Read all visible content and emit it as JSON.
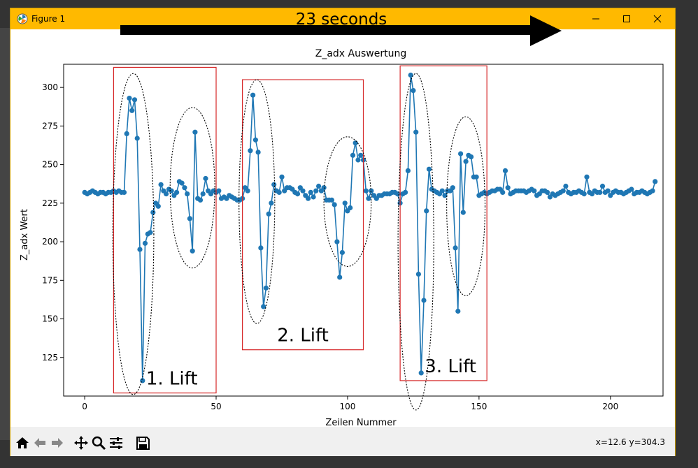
{
  "window": {
    "title": "Figure 1",
    "icon": "matplotlib-icon",
    "accent_color": "#ffb900"
  },
  "overlay": {
    "arrow_label": "23 seconds",
    "lift_labels": [
      "1. Lift",
      "2. Lift",
      "3. Lift"
    ],
    "box_color": "#d62728"
  },
  "toolbar": {
    "buttons": [
      "home-icon",
      "back-icon",
      "forward-icon",
      "pan-icon",
      "zoom-icon",
      "configure-subplots-icon",
      "save-icon"
    ],
    "coordinates": "x=12.6 y=304.3"
  },
  "chart_data": {
    "type": "line",
    "title": "Z_adx Auswertung",
    "xlabel": "Zeilen Nummer",
    "ylabel": "Z_adx Wert",
    "xlim": [
      -8,
      220
    ],
    "ylim": [
      100,
      315
    ],
    "xticks": [
      0,
      50,
      100,
      150,
      200
    ],
    "yticks": [
      125,
      150,
      175,
      200,
      225,
      250,
      275,
      300
    ],
    "series_color": "#1f77b4",
    "marker": "circle",
    "grid": false,
    "y": [
      232,
      231,
      232,
      233,
      232,
      231,
      232,
      232,
      231,
      232,
      232,
      233,
      232,
      233,
      232,
      232,
      270,
      293,
      285,
      292,
      267,
      195,
      110,
      199,
      205,
      206,
      219,
      225,
      223,
      237,
      233,
      231,
      234,
      233,
      230,
      232,
      239,
      238,
      235,
      231,
      215,
      194,
      271,
      228,
      227,
      231,
      241,
      233,
      231,
      233,
      232,
      233,
      228,
      229,
      228,
      230,
      229,
      228,
      227,
      227,
      228,
      235,
      233,
      259,
      295,
      266,
      258,
      196,
      158,
      170,
      218,
      225,
      237,
      233,
      232,
      242,
      233,
      235,
      235,
      234,
      232,
      231,
      235,
      233,
      230,
      228,
      232,
      229,
      233,
      236,
      233,
      235,
      227,
      227,
      227,
      224,
      200,
      177,
      193,
      225,
      220,
      222,
      256,
      264,
      253,
      256,
      253,
      233,
      228,
      233,
      230,
      228,
      230,
      230,
      231,
      231,
      231,
      232,
      232,
      231,
      225,
      231,
      232,
      246,
      308,
      298,
      271,
      179,
      115,
      162,
      220,
      247,
      234,
      233,
      232,
      231,
      233,
      230,
      233,
      233,
      235,
      196,
      155,
      257,
      219,
      252,
      256,
      255,
      242,
      242,
      230,
      231,
      232,
      231,
      232,
      233,
      233,
      234,
      234,
      232,
      246,
      235,
      231,
      232,
      233,
      233,
      233,
      233,
      232,
      233,
      234,
      233,
      230,
      231,
      233,
      233,
      232,
      229,
      231,
      230,
      231,
      232,
      233,
      236,
      232,
      231,
      232,
      232,
      233,
      232,
      231,
      242,
      232,
      231,
      233,
      232,
      232,
      236,
      232,
      233,
      230,
      232,
      233,
      232,
      232,
      231,
      232,
      233,
      234,
      231,
      232,
      232,
      233,
      232,
      231,
      232,
      233,
      239
    ],
    "annotations": [
      {
        "label": "1. Lift",
        "x_range": [
          11,
          50
        ],
        "y_range": [
          102,
          313
        ]
      },
      {
        "label": "2. Lift",
        "x_range": [
          60,
          106
        ],
        "y_range": [
          130,
          305
        ]
      },
      {
        "label": "3. Lift",
        "x_range": [
          120,
          153
        ],
        "y_range": [
          110,
          314
        ]
      }
    ]
  }
}
